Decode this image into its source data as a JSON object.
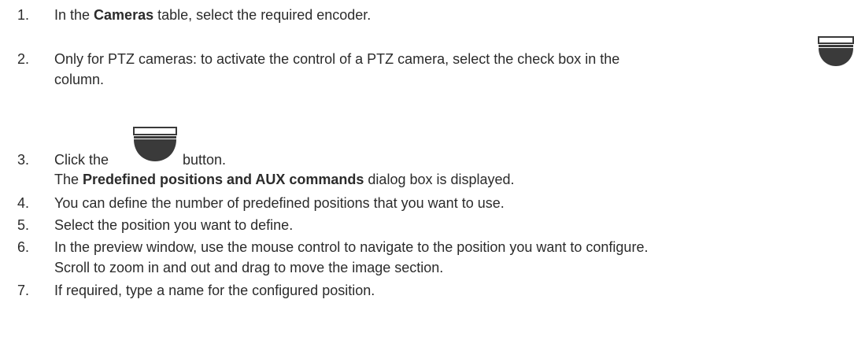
{
  "steps": [
    {
      "number": "1.",
      "before": "In the ",
      "bold": "Cameras",
      "after": " table, select the required encoder."
    },
    {
      "number": "2.",
      "line1": "Only for PTZ cameras: to activate the control of a PTZ camera, select the check box in the",
      "line2": "column.",
      "icon": "ptz-dome-camera-icon"
    },
    {
      "number": "3.",
      "before": "Click the",
      "after": "button.",
      "icon": "ptz-dome-camera-icon",
      "result_bold": "Predefined positions and AUX commands",
      "result_after": " dialog box is displayed.",
      "result_before": "The "
    },
    {
      "number": "4.",
      "text": "You can define the number of predefined positions that you want to use."
    },
    {
      "number": "5.",
      "text": "Select the position you want to define."
    },
    {
      "number": "6.",
      "line1": "In the preview window, use the mouse control to navigate to the position you want to configure.",
      "line2": "Scroll to zoom in and out and drag to move the image section."
    },
    {
      "number": "7.",
      "text": "If required, type a name for the configured position."
    }
  ],
  "colors": {
    "text": "#2b2b2b",
    "icon": "#3a3a3a"
  }
}
